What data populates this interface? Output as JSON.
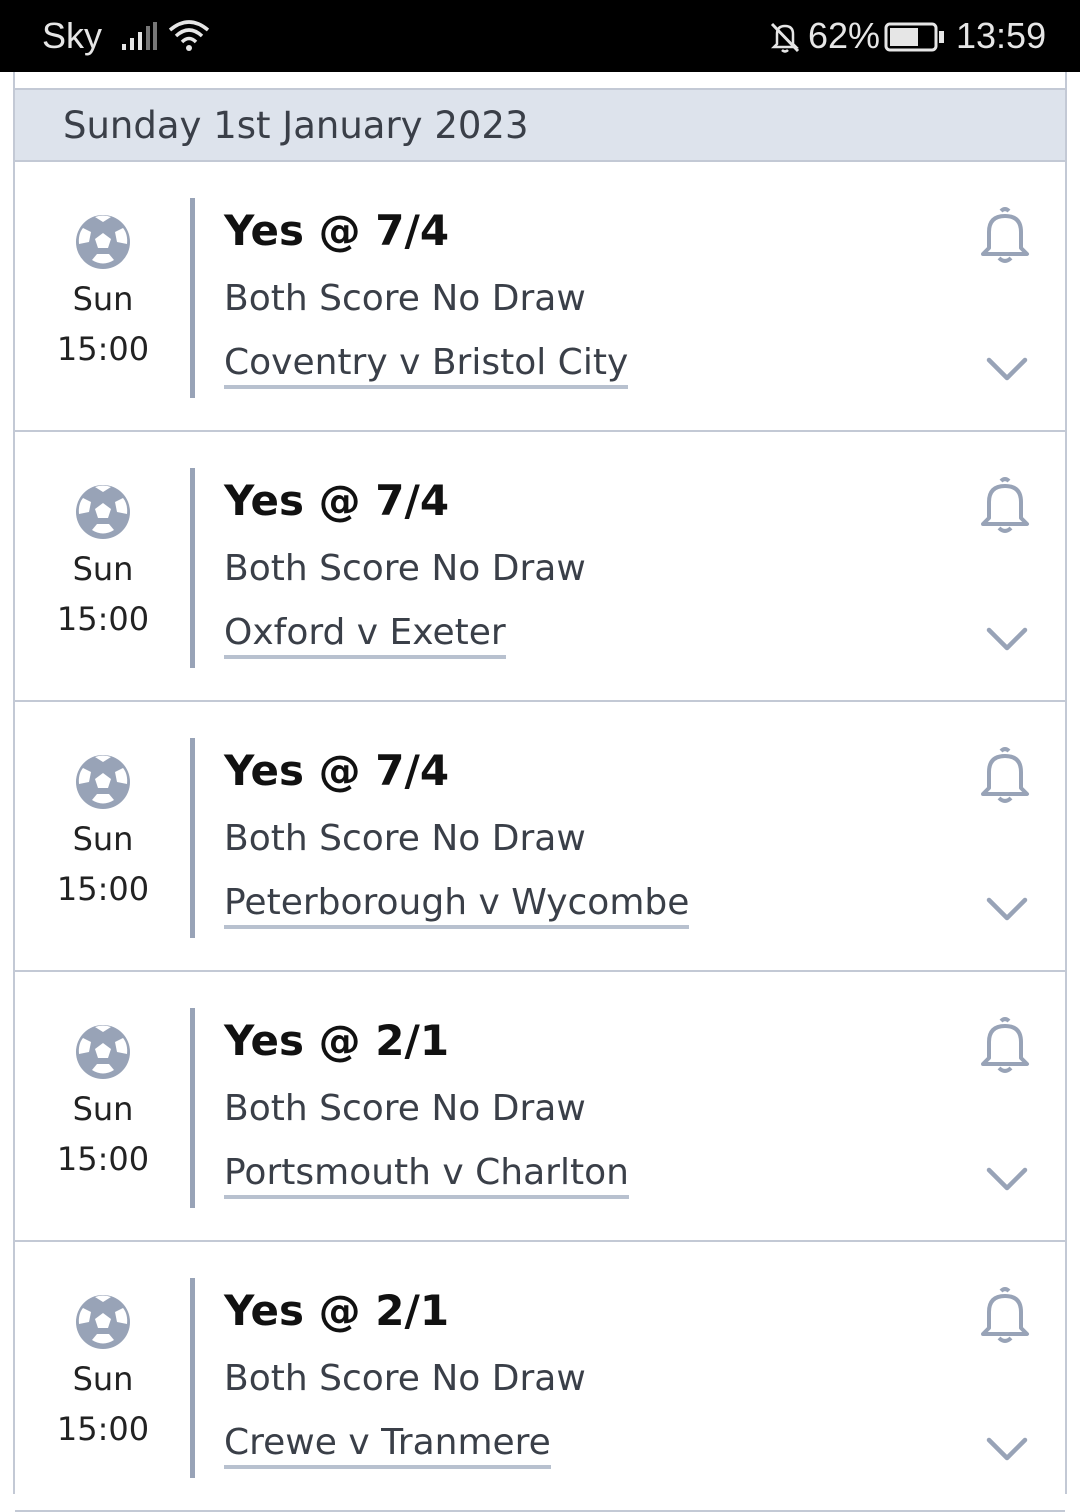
{
  "status_bar": {
    "carrier": "Sky",
    "battery": "62%",
    "time": "13:59"
  },
  "date_header": "Sunday 1st January 2023",
  "colors": {
    "accent_grey": "#98a3b7",
    "header_bg": "#dde3ec",
    "border": "#c3c9d5"
  },
  "bets": [
    {
      "day": "Sun",
      "time": "15:00",
      "odds": "Yes @ 7/4",
      "market": "Both Score No Draw",
      "match": "Coventry v Bristol City"
    },
    {
      "day": "Sun",
      "time": "15:00",
      "odds": "Yes @ 7/4",
      "market": "Both Score No Draw",
      "match": "Oxford v Exeter"
    },
    {
      "day": "Sun",
      "time": "15:00",
      "odds": "Yes @ 7/4",
      "market": "Both Score No Draw",
      "match": "Peterborough v Wycombe"
    },
    {
      "day": "Sun",
      "time": "15:00",
      "odds": "Yes @ 2/1",
      "market": "Both Score No Draw",
      "match": "Portsmouth v Charlton"
    },
    {
      "day": "Sun",
      "time": "15:00",
      "odds": "Yes @ 2/1",
      "market": "Both Score No Draw",
      "match": "Crewe v Tranmere"
    }
  ]
}
